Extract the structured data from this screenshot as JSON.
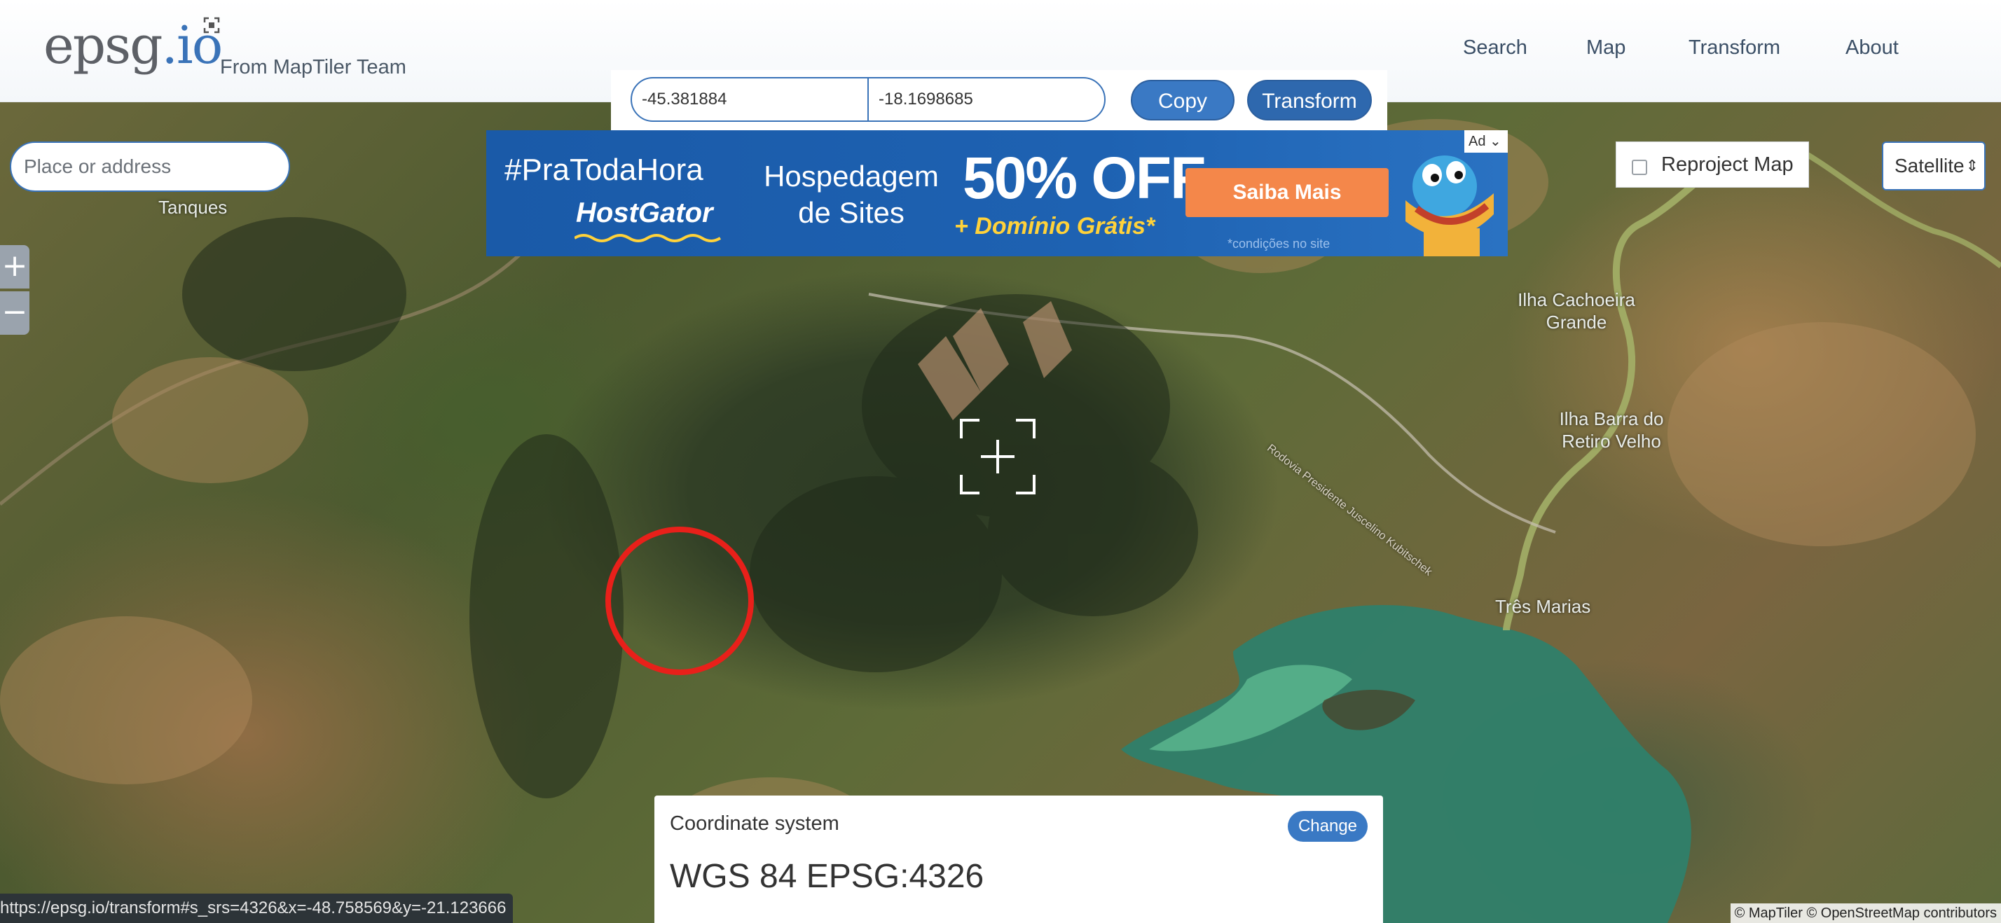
{
  "header": {
    "logo_main": "epsg",
    "logo_suffix": ".io",
    "tagline": "From MapTiler Team",
    "nav": [
      "Search",
      "Map",
      "Transform",
      "About"
    ]
  },
  "coords": {
    "x_value": "-45.381884",
    "y_value": "-18.1698685",
    "copy_label": "Copy",
    "transform_label": "Transform"
  },
  "ad": {
    "hashtag": "#PraTodaHora",
    "brand": "HostGator",
    "service": "Hospedagem de Sites",
    "offer": "50% OFF",
    "bonus": "+ Domínio Grátis*",
    "cta": "Saiba Mais",
    "disclaimer": "*condições no site",
    "ad_tag": "Ad"
  },
  "search": {
    "placeholder": "Place or address"
  },
  "zoom": {
    "in_label": "+",
    "out_label": "−"
  },
  "map_controls": {
    "reproject_label": "Reproject Map",
    "reproject_checked": false,
    "layer_selected": "Satellite"
  },
  "map_labels": {
    "tanques": "Tanques",
    "ilha_cachoeira": "Ilha Cachoeira Grande",
    "ilha_barra": "Ilha Barra do Retiro Velho",
    "tres_marias": "Três Marias",
    "road_1": "Rodovia Presidente Juscelino Kubitschek"
  },
  "coordinate_system": {
    "title": "Coordinate system",
    "change_label": "Change",
    "value": "WGS 84 EPSG:4326"
  },
  "status_url": "https://epsg.io/transform#s_srs=4326&x=-48.758569&y=-21.123666",
  "attribution": "© MapTiler © OpenStreetMap contributors",
  "colors": {
    "accent": "#3a73b8",
    "highlight_circle": "#e8201a",
    "ad_background": "#1a5aa8",
    "ad_cta": "#f4874a"
  },
  "icons": [
    "expand-icon",
    "crosshair-icon",
    "select-arrows-icon",
    "gator-mascot",
    "ad-choices-icon"
  ]
}
